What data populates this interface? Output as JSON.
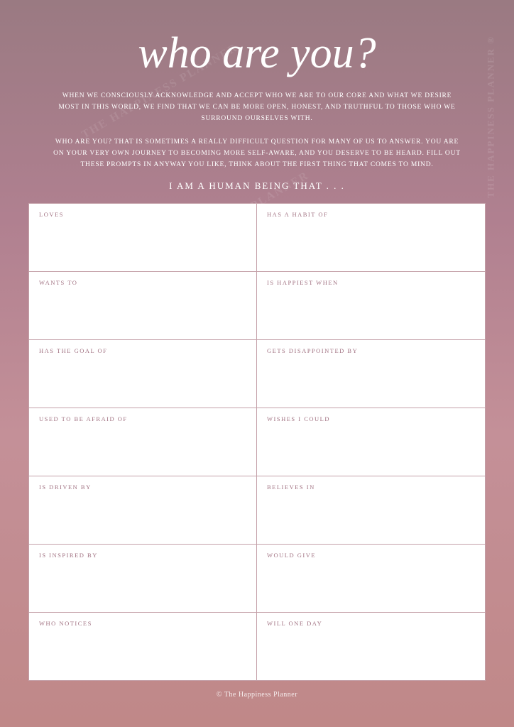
{
  "page": {
    "title": "who are you?",
    "subtitle1": "WHEN WE CONSCIOUSLY ACKNOWLEDGE AND ACCEPT WHO WE ARE TO OUR CORE AND WHAT WE DESIRE MOST IN THIS WORLD, WE FIND THAT WE CAN BE MORE OPEN, HONEST, AND TRUTHFUL TO THOSE WHO WE SURROUND OURSELVES WITH.",
    "subtitle2": "WHO ARE YOU? THAT IS SOMETIMES A REALLY DIFFICULT QUESTION FOR MANY OF US TO ANSWER. YOU ARE ON YOUR VERY OWN JOURNEY TO BECOMING MORE SELF-AWARE, AND YOU DESERVE TO BE HEARD. FILL OUT THESE PROMPTS IN ANYWAY YOU LIKE, THINK ABOUT THE FIRST THING THAT COMES TO MIND.",
    "section_label": "I AM A HUMAN BEING THAT . . .",
    "footer": "© The Happiness Planner",
    "watermark": "THE HAPPINESS PLANNER",
    "grid": [
      {
        "left_label": "LOVES",
        "right_label": "HAS A HABIT OF"
      },
      {
        "left_label": "WANTS TO",
        "right_label": "IS HAPPIEST WHEN"
      },
      {
        "left_label": "HAS THE GOAL OF",
        "right_label": "GETS DISAPPOINTED BY"
      },
      {
        "left_label": "USED TO BE AFRAID OF",
        "right_label": "WISHES I COULD"
      },
      {
        "left_label": "IS DRIVEN BY",
        "right_label": "BELIEVES IN"
      },
      {
        "left_label": "IS INSPIRED BY",
        "right_label": "WOULD GIVE"
      },
      {
        "left_label": "WHO NOTICES",
        "right_label": "WILL ONE DAY"
      }
    ]
  }
}
